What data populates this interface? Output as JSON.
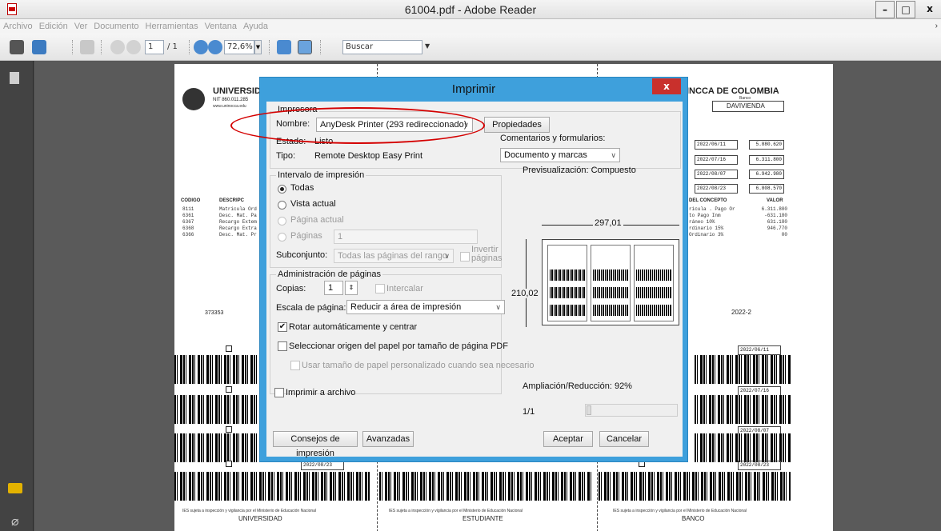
{
  "window": {
    "title": "61004.pdf - Adobe Reader",
    "minimize": "–",
    "maximize": "□",
    "close": "x"
  },
  "menu": [
    "Archivo",
    "Edición",
    "Ver",
    "Documento",
    "Herramientas",
    "Ventana",
    "Ayuda"
  ],
  "toolbar": {
    "page_current": "1",
    "page_total": "/ 1",
    "zoom": "72,6%",
    "search_placeholder": "Buscar"
  },
  "document": {
    "university_heading": "UNIVERSIDA",
    "university_nit": "NIT 860.011.285",
    "university_web": "www.uninocca.edu",
    "bank_heading": "INCCA DE COLOMBIA",
    "bank_sub": "Banco",
    "bank_name": "DAVIVIENDA",
    "concept_header": "DEL CONCEPTO",
    "value_header": "VALOR",
    "left_codes": [
      "8111",
      "6361",
      "6367",
      "6368",
      "6366"
    ],
    "left_header_codigo": "CODIGO",
    "left_header_desc": "DESCRIPC",
    "left_descs": [
      "Matrícula Ord",
      "Desc. Mat. Pa",
      "Recargo Extem",
      "Recargo Extra",
      "Desc. Mat. Pr"
    ],
    "right_concepts": [
      "ricula . Pago Or",
      "to Pago Inm",
      "ráneo 10%",
      "rdinario 15%",
      "Ordinario 3%"
    ],
    "right_values": [
      "6.311.800",
      "-631.180",
      "631.180",
      "946.770",
      "00"
    ],
    "dates": [
      "2022/06/11",
      "2022/07/16",
      "2022/08/07",
      "2022/08/23"
    ],
    "totals": [
      "5.880.620",
      "6.311.800",
      "6.942.980",
      "6.808.570"
    ],
    "student_code": "373353",
    "period": "2022-2",
    "stub_dates": [
      "2022/06/11",
      "2022/07/16",
      "2022/08/07",
      "2022/08/23"
    ],
    "footer_left": "UNIVERSIDAD",
    "footer_mid": "ESTUDIANTE",
    "footer_right": "BANCO",
    "footer_note": "IES sujeta a inspección y vigilancia por el Ministerio de Educación Nacional"
  },
  "dialog": {
    "title": "Imprimir",
    "close": "x",
    "printer_group": "Impresora",
    "name_label": "Nombre:",
    "printer_name": "AnyDesk Printer (293 redireccionado)",
    "properties_button": "Propiedades",
    "status_label": "Estado:",
    "status_value": "Listo",
    "type_label": "Tipo:",
    "type_value": "Remote Desktop Easy Print",
    "comments_label": "Comentarios y formularios:",
    "comments_value": "Documento y marcas",
    "range_group": "Intervalo de impresión",
    "range_all": "Todas",
    "range_current_view": "Vista actual",
    "range_current_page": "Página actual",
    "range_pages": "Páginas",
    "pages_value": "1",
    "subset_label": "Subconjunto:",
    "subset_value": "Todas las páginas del rango",
    "invert_pages": "Invertir páginas",
    "page_mgmt_group": "Administración de páginas",
    "copies_label": "Copias:",
    "copies_value": "1",
    "collate": "Intercalar",
    "scale_label": "Escala de página:",
    "scale_value": "Reducir a área de impresión",
    "auto_rotate": "Rotar automáticamente y centrar",
    "paper_source": "Seleccionar origen del papel por tamaño de página PDF",
    "custom_paper": "Usar tamaño de papel personalizado cuando sea necesario",
    "print_to_file": "Imprimir a archivo",
    "preview_label": "Previsualización: Compuesto",
    "preview_width": "297,01",
    "preview_height": "210,02",
    "zoom_label": "Ampliación/Reducción:  92%",
    "page_indicator": "1/1",
    "tips_button": "Consejos de impresión",
    "advanced_button": "Avanzadas",
    "accept_button": "Aceptar",
    "cancel_button": "Cancelar"
  }
}
